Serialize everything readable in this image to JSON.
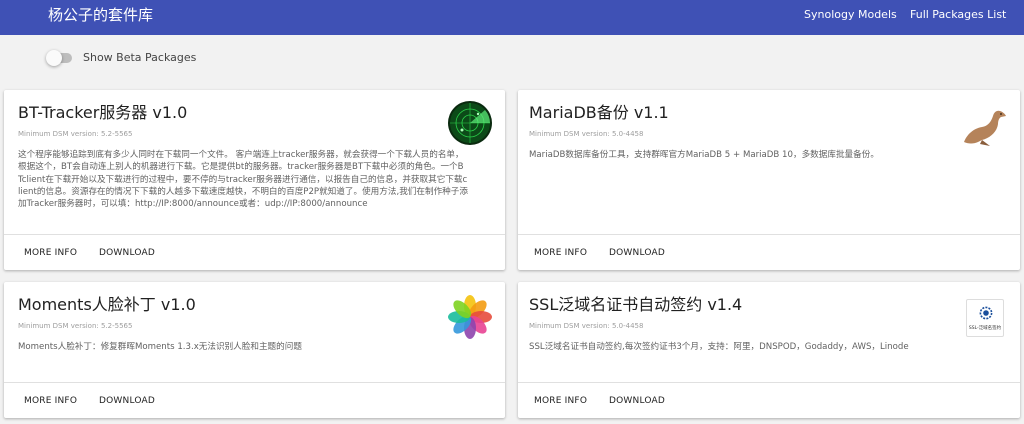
{
  "header": {
    "brand": "杨公子的套件库",
    "nav": [
      "Synology Models",
      "Full Packages List"
    ]
  },
  "beta": {
    "label": "Show Beta Packages"
  },
  "actions": {
    "more_info": "MORE INFO",
    "download": "DOWNLOAD"
  },
  "packages": [
    {
      "title": "BT-Tracker服务器 v1.0",
      "dsm": "Minimum DSM version: 5.2-5565",
      "description": "这个程序能够追踪到底有多少人同时在下载同一个文件。 客户端连上tracker服务器，就会获得一个下载人员的名单，根据这个，BT会自动连上别人的机器进行下载。它是提供bt的服务器。tracker服务器是BT下载中必须的角色。一个BTclient在下载开始以及下载进行的过程中，要不停的与tracker服务器进行通信，以报告自己的信息，并获取其它下载client的信息。资源存在的情况下下载的人越多下载速度越快，不明白的百度P2P就知道了。使用方法,我们在制作种子添加Tracker服务器时，可以填：http://IP:8000/announce或者：udp://IP:8000/announce",
      "icon": "radar-icon"
    },
    {
      "title": "MariaDB备份 v1.1",
      "dsm": "Minimum DSM version: 5.0-4458",
      "description": "MariaDB数据库备份工具，支持群晖官方MariaDB 5 + MariaDB 10，多数据库批量备份。",
      "icon": "sea-lion-icon"
    },
    {
      "title": "Moments人脸补丁 v1.0",
      "dsm": "Minimum DSM version: 5.2-5565",
      "description": "Moments人脸补丁：修复群晖Moments 1.3.x无法识别人脸和主题的问题",
      "icon": "pinwheel-icon"
    },
    {
      "title": "SSL泛域名证书自动签约 v1.4",
      "dsm": "Minimum DSM version: 5.0-4458",
      "description": "SSL泛域名证书自动签约,每次签约证书3个月，支持：阿里，DNSPOD，Godaddy，AWS，Linode",
      "icon": "ssl-badge-icon",
      "icon_text": "SSL-泛域名签约"
    }
  ],
  "colors": {
    "header": "#3f51b5",
    "background": "#f2f2f2",
    "card": "#ffffff"
  }
}
